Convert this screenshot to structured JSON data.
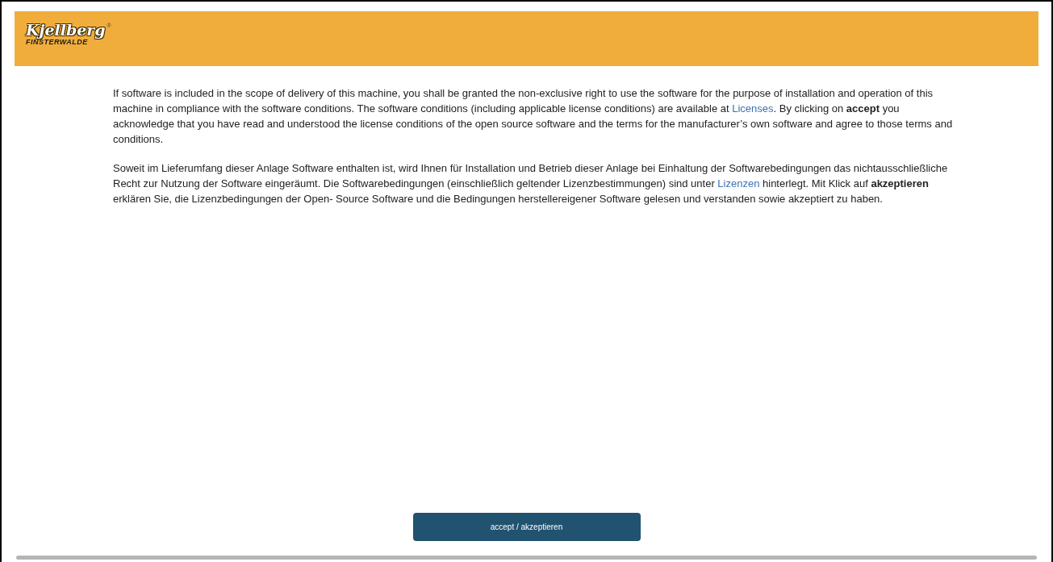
{
  "logo": {
    "name": "Kjellberg",
    "mark": "®",
    "subtitle": "FINSTERWALDE"
  },
  "paragraphs": [
    {
      "before": "If software is included in the scope of delivery of this machine, you shall be granted the non-exclusive right to use the software for the purpose of installation and operation of this machine in compliance with the software conditions. The software conditions (including applicable license conditions) are available at ",
      "link": "Licenses",
      "after": ". By clicking on **accept** you acknowledge that you have read and understood the license conditions of the open source software and the terms for the manufacturer’s own software and agree to those terms and conditions."
    },
    {
      "before": "Soweit im Lieferumfang dieser Anlage Software enthalten ist, wird Ihnen für Installation und Betrieb dieser Anlage bei Einhaltung der Softwarebedingungen das nichtausschließliche Recht zur Nutzung der Software eingeräumt. Die Softwarebedingungen (einschließlich geltender Lizenzbestimmungen) sind unter ",
      "link": "Lizenzen",
      "after": " hinterlegt. Mit Klick auf **akzeptieren** erklären Sie, die Lizenzbedingungen der Open- Source Software und die Bedingungen herstellereigener Software gelesen und verstanden sowie akzeptiert zu haben."
    }
  ],
  "accept_button": "accept / akzeptieren"
}
